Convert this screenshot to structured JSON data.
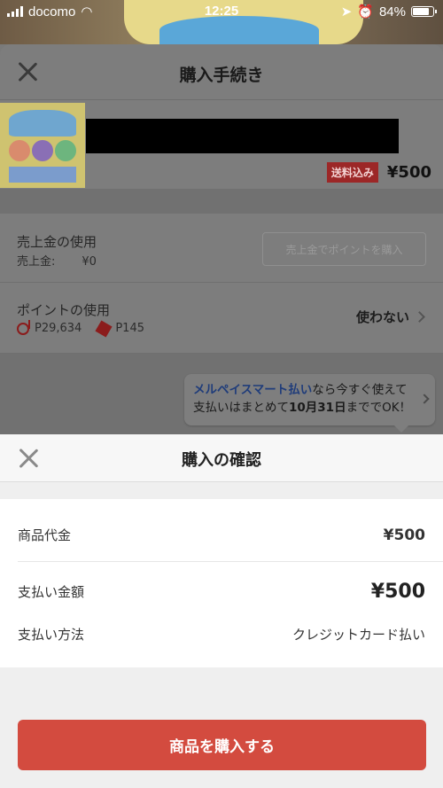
{
  "status_bar": {
    "carrier": "docomo",
    "time": "12:25",
    "battery": "84%",
    "battery_level": 0.84
  },
  "purchase_sheet": {
    "title": "購入手続き",
    "item": {
      "shipping_badge": "送料込み",
      "price": "¥500"
    },
    "sales": {
      "label": "売上金の使用",
      "sub_label": "売上金:",
      "sub_value": "¥0",
      "button": "売上金でポイントを購入"
    },
    "points": {
      "label": "ポイントの使用",
      "d_points": "P29,634",
      "m_points": "P145",
      "action": "使わない"
    },
    "promo": {
      "highlight": "メルペイスマート払い",
      "line1_rest": "なら今すぐ使えて",
      "line2_pre": "支払いはまとめて",
      "line2_bold": "10月31日",
      "line2_post": "まででOK！"
    }
  },
  "confirm_sheet": {
    "title": "購入の確認",
    "rows": [
      {
        "label": "商品代金",
        "value": "¥500"
      },
      {
        "label": "支払い金額",
        "value": "¥500"
      },
      {
        "label": "支払い方法",
        "value": "クレジットカード払い"
      }
    ],
    "buy_button": "商品を購入する"
  },
  "colors": {
    "accent": "#d34b3f",
    "link": "#1f3c7a"
  }
}
